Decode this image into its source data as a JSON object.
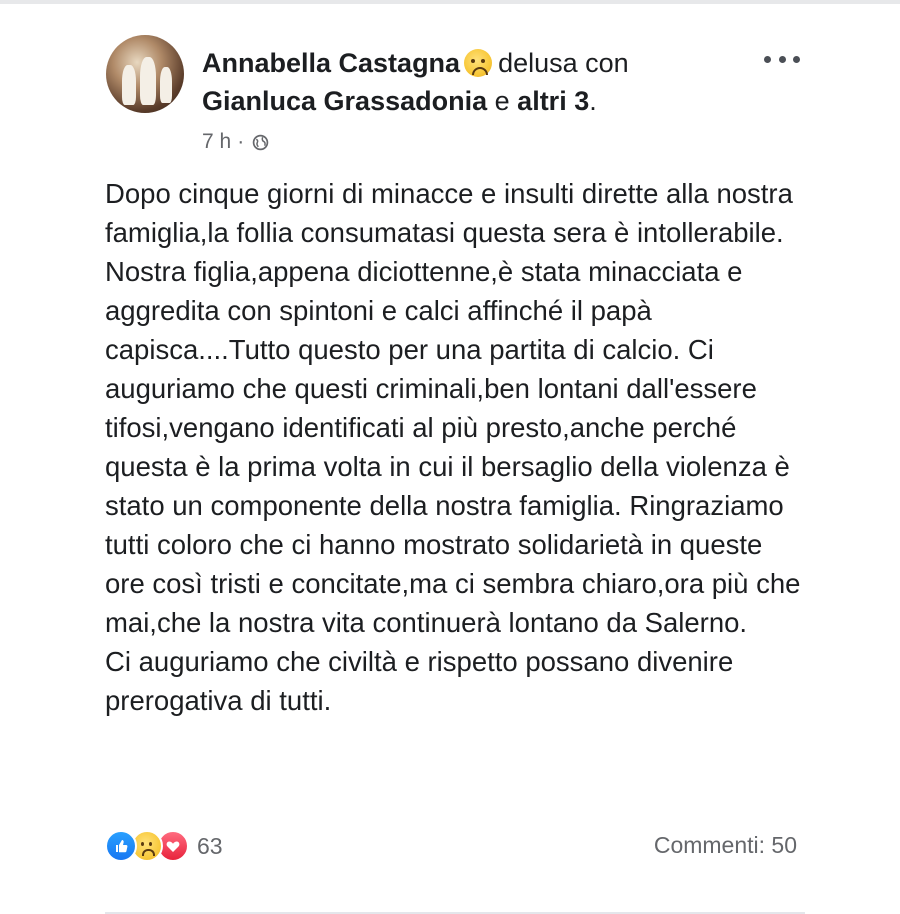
{
  "post": {
    "author": "Annabella Castagna",
    "feeling_emoji": "sad-face-icon",
    "feeling_text": "delusa con",
    "tagged_name": "Gianluca Grassadonia",
    "tagged_connector": "e",
    "tagged_others": "altri 3",
    "tagged_end": ".",
    "time": "7 h",
    "separator": "·",
    "privacy_icon": "globe-icon",
    "body_paragraphs": [
      "Dopo cinque giorni di minacce e insulti dirette alla nostra famiglia,la follia consumatasi questa sera è intollerabile. Nostra figlia,appena diciottenne,è stata minacciata e aggredita con spintoni e calci affinché il papà capisca....Tutto questo per una partita di calcio. Ci auguriamo che questi criminali,ben lontani dall'essere tifosi,vengano identificati al più presto,anche perché questa è la prima volta in cui il bersaglio della violenza è stato un componente della nostra famiglia. Ringraziamo tutti coloro che ci hanno mostrato solidarietà in queste ore così tristi e concitate,ma ci sembra chiaro,ora più che mai,che la nostra vita continuerà lontano da Salerno.",
      "Ci auguriamo che civiltà e rispetto possano divenire prerogativa di tutti."
    ]
  },
  "footer": {
    "reaction_icons": [
      "like-icon",
      "sad-icon",
      "love-icon"
    ],
    "reaction_count": "63",
    "comments_label": "Commenti: 50"
  },
  "colors": {
    "text": "#1c1e21",
    "meta": "#65676b",
    "like": "#1877f2",
    "love": "#e8233c"
  }
}
